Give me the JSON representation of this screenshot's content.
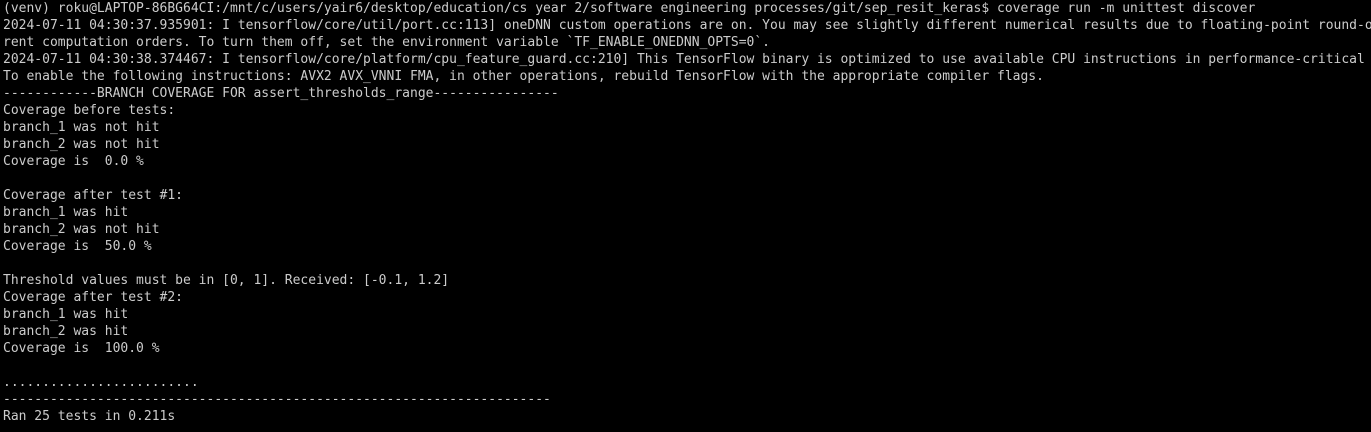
{
  "terminal": {
    "lines": [
      "(venv) roku@LAPTOP-86BG64CI:/mnt/c/users/yair6/desktop/education/cs year 2/software engineering processes/git/sep_resit_keras$ coverage run -m unittest discover",
      "2024-07-11 04:30:37.935901: I tensorflow/core/util/port.cc:113] oneDNN custom operations are on. You may see slightly different numerical results due to floating-point round-off errors from diffe",
      "rent computation orders. To turn them off, set the environment variable `TF_ENABLE_ONEDNN_OPTS=0`.",
      "2024-07-11 04:30:38.374467: I tensorflow/core/platform/cpu_feature_guard.cc:210] This TensorFlow binary is optimized to use available CPU instructions in performance-critical operations.",
      "To enable the following instructions: AVX2 AVX_VNNI FMA, in other operations, rebuild TensorFlow with the appropriate compiler flags.",
      "------------BRANCH COVERAGE FOR assert_thresholds_range----------------",
      "Coverage before tests:",
      "branch_1 was not hit",
      "branch_2 was not hit",
      "Coverage is  0.0 %",
      "",
      "Coverage after test #1:",
      "branch_1 was hit",
      "branch_2 was not hit",
      "Coverage is  50.0 %",
      "",
      "Threshold values must be in [0, 1]. Received: [-0.1, 1.2]",
      "Coverage after test #2:",
      "branch_1 was hit",
      "branch_2 was hit",
      "Coverage is  100.0 %",
      "",
      ".........................",
      "----------------------------------------------------------------------",
      "Ran 25 tests in 0.211s"
    ]
  }
}
